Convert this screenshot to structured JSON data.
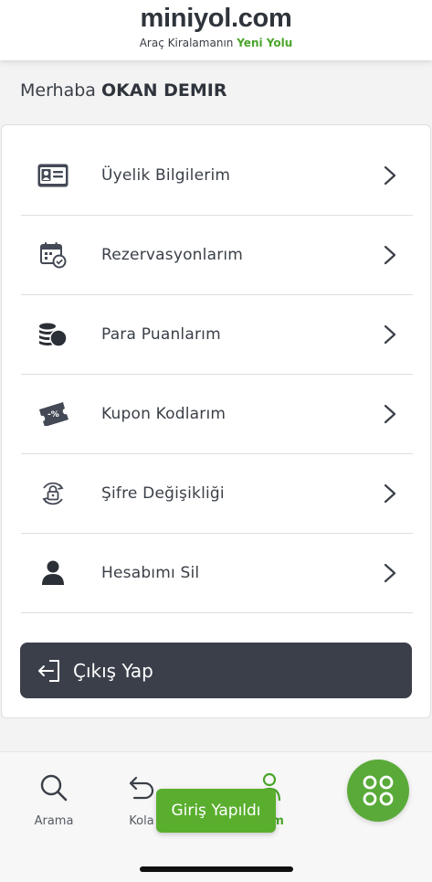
{
  "header": {
    "logo": "miniyol.com",
    "tagline_prefix": "Araç Kiralamanın",
    "tagline_highlight": "Yeni Yolu"
  },
  "greeting": {
    "prefix": "Merhaba",
    "name": "OKAN DEMIR"
  },
  "menu": {
    "items": [
      {
        "label": "Üyelik Bilgilerim",
        "icon": "id-card-icon"
      },
      {
        "label": "Rezervasyonlarım",
        "icon": "calendar-check-icon"
      },
      {
        "label": "Para Puanlarım",
        "icon": "coins-icon"
      },
      {
        "label": "Kupon Kodlarım",
        "icon": "coupon-icon"
      },
      {
        "label": "Şifre Değişikliği",
        "icon": "lock-refresh-icon"
      },
      {
        "label": "Hesabımı Sil",
        "icon": "user-icon"
      }
    ]
  },
  "logout": {
    "label": "Çıkış Yap",
    "icon": "logout-icon"
  },
  "tabbar": {
    "tabs": [
      {
        "label": "Arama",
        "icon": "search-icon"
      },
      {
        "label": "Kola",
        "icon": "return-icon"
      },
      {
        "label": "ıbım",
        "icon": "user-icon"
      }
    ],
    "fab_icon": "grid-menu-icon"
  },
  "toast": {
    "text": "Giriş Yapıldı"
  },
  "colors": {
    "brand_green": "#5aaa3a",
    "dark": "#3b3f4a",
    "text": "#3a3f47"
  }
}
